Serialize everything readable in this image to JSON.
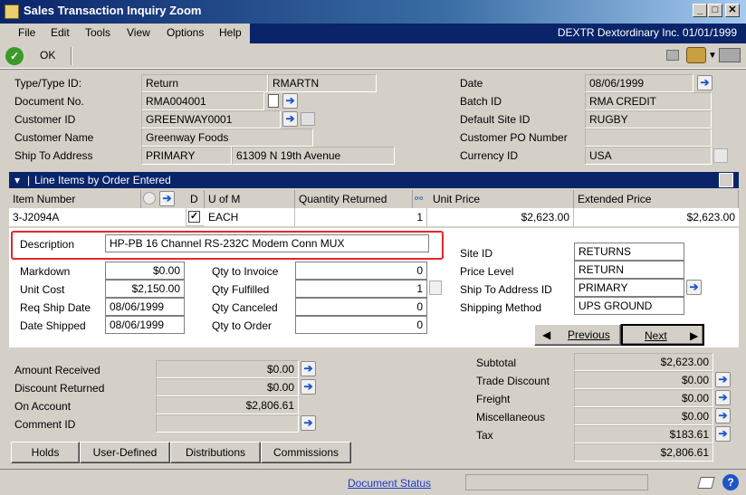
{
  "window": {
    "title": "Sales Transaction Inquiry Zoom"
  },
  "menu": {
    "items": [
      "File",
      "Edit",
      "Tools",
      "View",
      "Options",
      "Help"
    ],
    "company": "DEXTR  Dextordinary Inc.  01/01/1999"
  },
  "toolbar": {
    "ok_label": "OK"
  },
  "header": {
    "type_label": "Type/Type ID:",
    "type_value": "Return",
    "type_id_value": "RMARTN",
    "docno_label": "Document No.",
    "docno_value": "RMA004001",
    "customer_id_label": "Customer ID",
    "customer_id_value": "GREENWAY0001",
    "customer_name_label": "Customer Name",
    "customer_name_value": "Greenway Foods",
    "ship_to_label": "Ship To Address",
    "ship_to_id": "PRIMARY",
    "ship_to_addr": "61309 N 19th Avenue",
    "date_label": "Date",
    "date_value": "08/06/1999",
    "batch_label": "Batch ID",
    "batch_value": "RMA CREDIT",
    "site_label": "Default Site ID",
    "site_value": "RUGBY",
    "po_label": "Customer PO Number",
    "po_value": "",
    "currency_label": "Currency ID",
    "currency_value": "USA"
  },
  "lines": {
    "section_title": "Line Items by Order Entered",
    "columns": {
      "item": "Item Number",
      "d": "D",
      "uofm": "U of M",
      "qty": "Quantity Returned",
      "unit_price": "Unit Price",
      "ext_price": "Extended Price"
    },
    "row": {
      "item": "3-J2094A",
      "uofm": "EACH",
      "qty": "1",
      "unit_price": "$2,623.00",
      "ext_price": "$2,623.00"
    }
  },
  "detail": {
    "desc_label": "Description",
    "desc_value": "HP-PB 16 Channel RS-232C Modem Conn MUX",
    "markdown_label": "Markdown",
    "markdown_value": "$0.00",
    "unit_cost_label": "Unit Cost",
    "unit_cost_value": "$2,150.00",
    "req_ship_label": "Req Ship Date",
    "req_ship_value": "08/06/1999",
    "date_shipped_label": "Date Shipped",
    "date_shipped_value": "08/06/1999",
    "qty_invoice_label": "Qty to Invoice",
    "qty_invoice_value": "0",
    "qty_fulfilled_label": "Qty Fulfilled",
    "qty_fulfilled_value": "1",
    "qty_canceled_label": "Qty Canceled",
    "qty_canceled_value": "0",
    "qty_order_label": "Qty to Order",
    "qty_order_value": "0",
    "site_id_label": "Site ID",
    "site_id_value": "RETURNS",
    "price_level_label": "Price Level",
    "price_level_value": "RETURN",
    "ship_to_id_label": "Ship To Address ID",
    "ship_to_id_value": "PRIMARY",
    "ship_method_label": "Shipping Method",
    "ship_method_value": "UPS GROUND",
    "previous_label": "Previous",
    "next_label": "Next"
  },
  "totals_left": {
    "amount_received_label": "Amount Received",
    "amount_received_value": "$0.00",
    "discount_returned_label": "Discount Returned",
    "discount_returned_value": "$0.00",
    "on_account_label": "On Account",
    "on_account_value": "$2,806.61",
    "comment_id_label": "Comment ID",
    "comment_id_value": ""
  },
  "totals_right": {
    "subtotal_label": "Subtotal",
    "subtotal_value": "$2,623.00",
    "trade_discount_label": "Trade Discount",
    "trade_discount_value": "$0.00",
    "freight_label": "Freight",
    "freight_value": "$0.00",
    "misc_label": "Miscellaneous",
    "misc_value": "$0.00",
    "tax_label": "Tax",
    "tax_value": "$183.61",
    "total_value": "$2,806.61"
  },
  "buttons": {
    "holds": "Holds",
    "user_defined": "User-Defined",
    "distributions": "Distributions",
    "commissions": "Commissions"
  },
  "status": {
    "document_status": "Document Status"
  },
  "colors": {
    "title_blue": "#0a246a",
    "highlight_red": "#e0282e",
    "link_blue": "#1e3cc8"
  }
}
